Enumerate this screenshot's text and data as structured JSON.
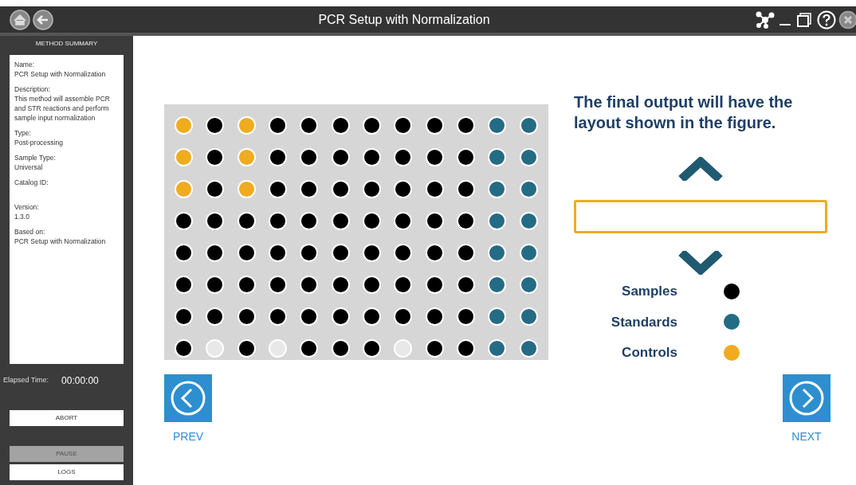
{
  "window": {
    "title": "PCR Setup with Normalization"
  },
  "sidebar": {
    "heading": "METHOD SUMMARY",
    "fields": [
      {
        "label": "Name:",
        "value": "PCR Setup with Normalization"
      },
      {
        "label": "Description:",
        "value": "This method will assemble PCR and STR reactions and perform sample input normalization"
      },
      {
        "label": "Type:",
        "value": "Post-processing"
      },
      {
        "label": "Sample Type:",
        "value": "Universal"
      },
      {
        "label": "Catalog ID:"
      },
      {
        "label": "Version:",
        "value": "1.3.0"
      },
      {
        "label": "Based on:",
        "value": "PCR Setup with Normalization"
      }
    ],
    "elapsed_label": "Elapsed Time:",
    "elapsed_value": "00:00:00",
    "buttons": [
      {
        "label": "ABORT",
        "disabled": false
      },
      {
        "label": "PAUSE",
        "disabled": true
      },
      {
        "label": "LOGS",
        "disabled": false
      }
    ]
  },
  "plate": {
    "rows": [
      [
        {
          "kind": "control"
        },
        {
          "kind": "sample"
        },
        {
          "kind": "control"
        },
        {
          "kind": "sample"
        },
        {
          "kind": "sample"
        },
        {
          "kind": "sample"
        },
        {
          "kind": "sample"
        },
        {
          "kind": "sample"
        },
        {
          "kind": "sample"
        },
        {
          "kind": "sample"
        },
        {
          "kind": "standard"
        },
        {
          "kind": "standard"
        }
      ],
      [
        {
          "kind": "control"
        },
        {
          "kind": "sample"
        },
        {
          "kind": "control"
        },
        {
          "kind": "sample"
        },
        {
          "kind": "sample"
        },
        {
          "kind": "sample"
        },
        {
          "kind": "sample"
        },
        {
          "kind": "sample"
        },
        {
          "kind": "sample"
        },
        {
          "kind": "sample"
        },
        {
          "kind": "standard"
        },
        {
          "kind": "standard"
        }
      ],
      [
        {
          "kind": "control"
        },
        {
          "kind": "sample"
        },
        {
          "kind": "control"
        },
        {
          "kind": "sample"
        },
        {
          "kind": "sample"
        },
        {
          "kind": "sample"
        },
        {
          "kind": "sample"
        },
        {
          "kind": "sample"
        },
        {
          "kind": "sample"
        },
        {
          "kind": "sample"
        },
        {
          "kind": "standard"
        },
        {
          "kind": "standard"
        }
      ],
      [
        {
          "kind": "sample"
        },
        {
          "kind": "sample"
        },
        {
          "kind": "sample"
        },
        {
          "kind": "sample"
        },
        {
          "kind": "sample"
        },
        {
          "kind": "sample"
        },
        {
          "kind": "sample"
        },
        {
          "kind": "sample"
        },
        {
          "kind": "sample"
        },
        {
          "kind": "sample"
        },
        {
          "kind": "standard"
        },
        {
          "kind": "standard"
        }
      ],
      [
        {
          "kind": "sample"
        },
        {
          "kind": "sample"
        },
        {
          "kind": "sample"
        },
        {
          "kind": "sample"
        },
        {
          "kind": "sample"
        },
        {
          "kind": "sample"
        },
        {
          "kind": "sample"
        },
        {
          "kind": "sample"
        },
        {
          "kind": "sample"
        },
        {
          "kind": "sample"
        },
        {
          "kind": "standard"
        },
        {
          "kind": "standard"
        }
      ],
      [
        {
          "kind": "sample"
        },
        {
          "kind": "sample"
        },
        {
          "kind": "sample"
        },
        {
          "kind": "sample"
        },
        {
          "kind": "sample"
        },
        {
          "kind": "sample"
        },
        {
          "kind": "sample"
        },
        {
          "kind": "sample"
        },
        {
          "kind": "sample"
        },
        {
          "kind": "sample"
        },
        {
          "kind": "standard"
        },
        {
          "kind": "standard"
        }
      ],
      [
        {
          "kind": "sample"
        },
        {
          "kind": "sample"
        },
        {
          "kind": "sample"
        },
        {
          "kind": "sample"
        },
        {
          "kind": "sample"
        },
        {
          "kind": "sample"
        },
        {
          "kind": "sample"
        },
        {
          "kind": "sample"
        },
        {
          "kind": "sample"
        },
        {
          "kind": "sample"
        },
        {
          "kind": "standard"
        },
        {
          "kind": "standard"
        }
      ],
      [
        {
          "kind": "sample"
        },
        {
          "kind": "empty"
        },
        {
          "kind": "sample"
        },
        {
          "kind": "empty"
        },
        {
          "kind": "sample"
        },
        {
          "kind": "sample"
        },
        {
          "kind": "sample"
        },
        {
          "kind": "empty"
        },
        {
          "kind": "sample"
        },
        {
          "kind": "sample"
        },
        {
          "kind": "standard"
        },
        {
          "kind": "standard"
        }
      ]
    ]
  },
  "heading": "The final output will have the layout shown in the figure.",
  "legend": [
    {
      "label": "Samples",
      "color": "#000000"
    },
    {
      "label": "Standards",
      "color": "#246b85"
    },
    {
      "label": "Controls",
      "color": "#f0ab1f"
    }
  ],
  "nav": {
    "prev": "PREV",
    "next": "NEXT"
  }
}
